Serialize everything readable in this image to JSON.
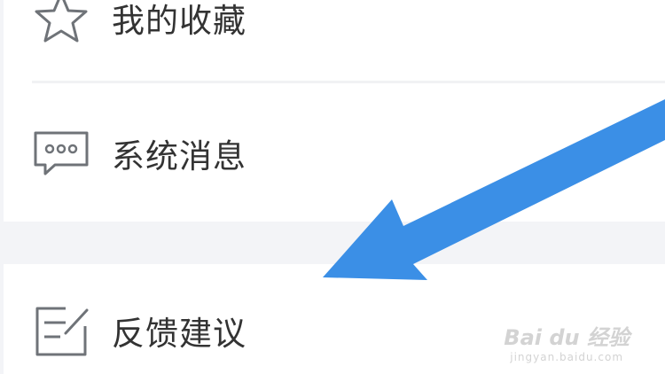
{
  "menu": {
    "favorites_label": "我的收藏",
    "messages_label": "系统消息",
    "feedback_label": "反馈建议"
  },
  "icons": {
    "favorites": "star-icon",
    "messages": "chat-bubble-icon",
    "feedback": "edit-note-icon"
  },
  "watermark": {
    "brand": "Bai du 经验",
    "url": "jingyan.baidu.com"
  },
  "colors": {
    "arrow": "#3b8fe6",
    "text": "#333333",
    "icon_stroke": "#6f7378",
    "background": "#f3f4f7"
  }
}
